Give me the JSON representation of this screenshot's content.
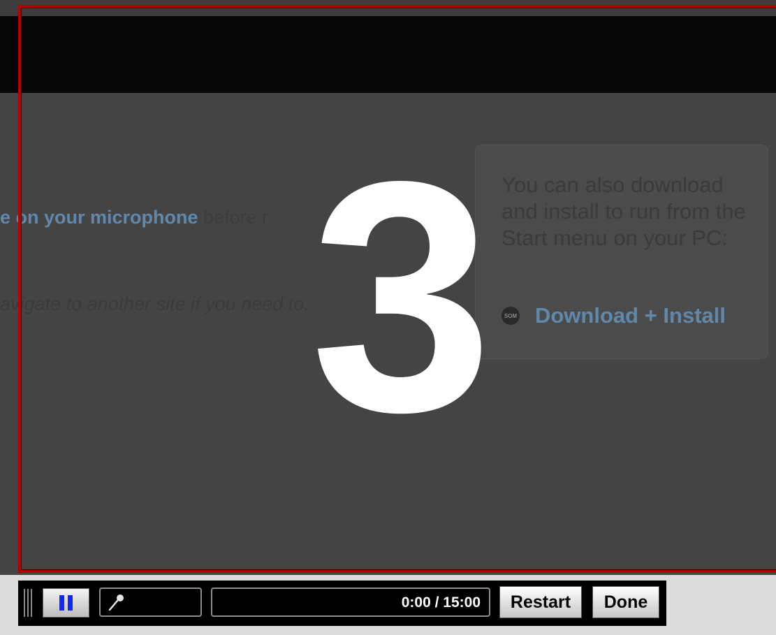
{
  "background_page": {
    "instruction_prefix": "e on your microphone",
    "instruction_suffix": " before r",
    "note": "avigate to another site if you need to.",
    "sidebar": {
      "text": "You can also download and install to run from the Start menu on your PC:",
      "download_icon_text": "SOM",
      "download_link": "Download + Install"
    }
  },
  "countdown": {
    "value": "3"
  },
  "control_bar": {
    "time": "0:00 / 15:00",
    "restart_label": "Restart",
    "done_label": "Done"
  },
  "colors": {
    "frame": "#b30000",
    "pause_bars": "#1226ff",
    "link": "#5f88aa"
  }
}
